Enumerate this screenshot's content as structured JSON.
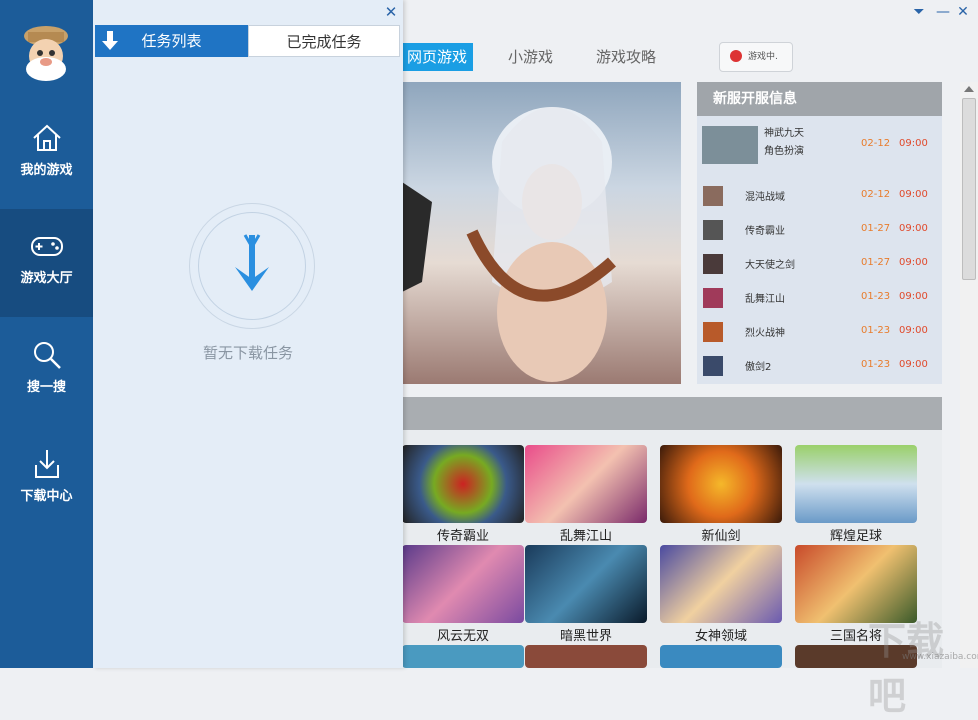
{
  "sidebar": {
    "items": [
      {
        "label": "我的游戏",
        "icon": "home-icon"
      },
      {
        "label": "游戏大厅",
        "icon": "gamepad-icon"
      },
      {
        "label": "搜一搜",
        "icon": "search-icon"
      },
      {
        "label": "下载中心",
        "icon": "download-icon"
      }
    ],
    "active_index": 1
  },
  "tabs": [
    "网页游戏",
    "小游戏",
    "游戏攻略"
  ],
  "playing_button": "游戏中.",
  "news": {
    "title": "新服开服信息",
    "feature": {
      "name": "神武九天",
      "sub": "角色扮演",
      "date": "02-12",
      "time": "09:00"
    },
    "rows": [
      {
        "name": "混沌战域",
        "date": "02-12",
        "time": "09:00"
      },
      {
        "name": "传奇霸业",
        "date": "01-27",
        "time": "09:00"
      },
      {
        "name": "大天使之剑",
        "date": "01-27",
        "time": "09:00"
      },
      {
        "name": "乱舞江山",
        "date": "01-23",
        "time": "09:00"
      },
      {
        "name": "烈火战神",
        "date": "01-23",
        "time": "09:00"
      },
      {
        "name": "傲剑2",
        "date": "01-23",
        "time": "09:00"
      }
    ]
  },
  "games": [
    {
      "name": "传奇霸业"
    },
    {
      "name": "乱舞江山"
    },
    {
      "name": "新仙剑"
    },
    {
      "name": "辉煌足球"
    },
    {
      "name": "风云无双"
    },
    {
      "name": "暗黑世界"
    },
    {
      "name": "女神领域"
    },
    {
      "name": "三国名将"
    }
  ],
  "panel": {
    "tab_active": "任务列表",
    "tab_inactive": "已完成任务",
    "empty_text": "暂无下载任务"
  },
  "watermark": {
    "text": "下载吧",
    "url": "www.xiazaiba.com"
  },
  "colors": {
    "sidebar": "#1c5c99",
    "accent": "#1a9ee4",
    "panel_bg": "#e4edf7",
    "date": "#e87c2c",
    "time": "#e04a2c"
  }
}
